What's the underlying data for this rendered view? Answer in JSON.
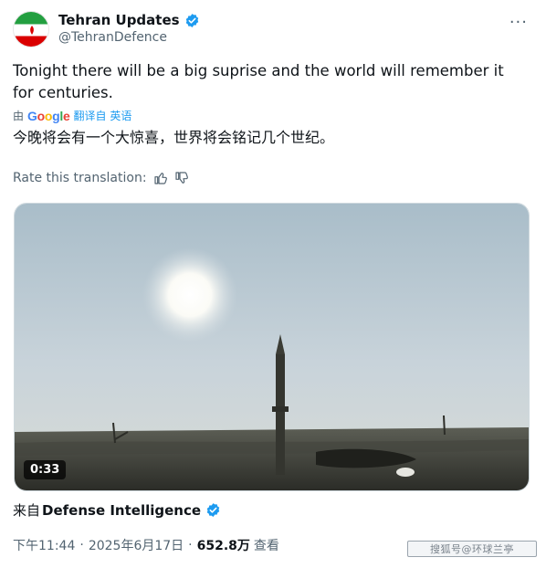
{
  "author": {
    "display_name": "Tehran Updates",
    "handle": "@TehranDefence",
    "verified": true,
    "avatar": "iran-flag-icon"
  },
  "menu_icon": "more-horizontal-icon",
  "menu_glyph": "···",
  "tweet": {
    "text": "Tonight there will be a big suprise and the world will remember it for centuries.",
    "translation_prefix": "由",
    "translation_provider": "Google",
    "translation_suffix": "翻译自 英语",
    "translated_text": "今晚将会有一个大惊喜，世界将会铭记几个世纪。",
    "rate_label": "Rate this translation:"
  },
  "media": {
    "duration": "0:33",
    "description_icon": "video-thumbnail"
  },
  "source": {
    "prefix": "来自",
    "name": "Defense Intelligence",
    "verified": true
  },
  "meta": {
    "time": "下午11:44",
    "date": "2025年6月17日",
    "separator": "·",
    "views": "652.8万",
    "views_label": "查看"
  },
  "watermark": {
    "text": "搜狐号@环球兰亭"
  },
  "colors": {
    "accent": "#1d9bf0",
    "text_primary": "#0f1419",
    "text_secondary": "#536471"
  }
}
